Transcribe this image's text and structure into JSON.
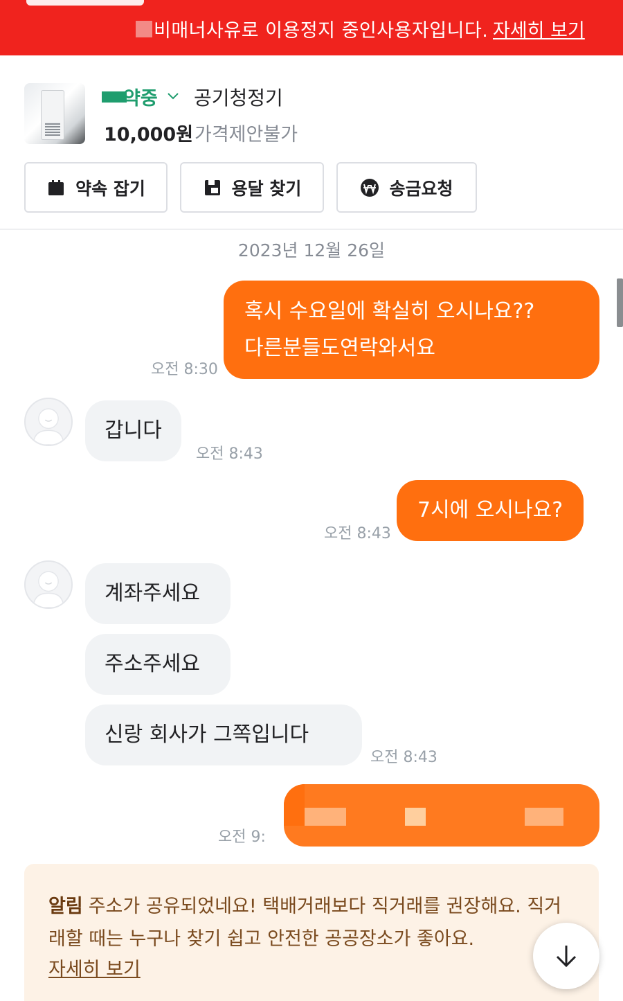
{
  "banner": {
    "text": "비매너사유로 이용정지 중인사용자입니다.",
    "link": "자세히 보기",
    "color": "#f0231e"
  },
  "product": {
    "status": "약중",
    "title": "공기청정기",
    "price": "10,000원",
    "price_note": "가격제안불가",
    "status_color": "#1f9d6e"
  },
  "actions": [
    {
      "label": "약속 잡기",
      "icon": "calendar-icon"
    },
    {
      "label": "용달 찾기",
      "icon": "truck-icon"
    },
    {
      "label": "송금요청",
      "icon": "won-icon"
    }
  ],
  "chat": {
    "date": "2023년 12월 26일",
    "messages": [
      {
        "from": "me",
        "lines": [
          "혹시 수요일에 확실히 오시나요??",
          "다른분들도연락와서요"
        ],
        "time": "오전 8:30"
      },
      {
        "from": "other",
        "text": "갑니다",
        "time": "오전 8:43"
      },
      {
        "from": "me",
        "text": "7시에 오시나요?",
        "time": "오전 8:43"
      },
      {
        "from": "other",
        "text": "계좌주세요"
      },
      {
        "from": "other",
        "text": "주소주세요"
      },
      {
        "from": "other",
        "text": "신랑 회사가 그쪽입니다",
        "time": "오전 8:43"
      },
      {
        "from": "me",
        "text": "",
        "time": "오전 9:"
      }
    ],
    "me_color": "#ff6f0f"
  },
  "notice": {
    "label": "알림",
    "text": "주소가 공유되었네요! 택배거래보다 직거래를 권장해요. 직거래할 때는 누구나 찾기 쉽고 안전한 공공장소가 좋아요.",
    "link": "자세히 보기"
  }
}
